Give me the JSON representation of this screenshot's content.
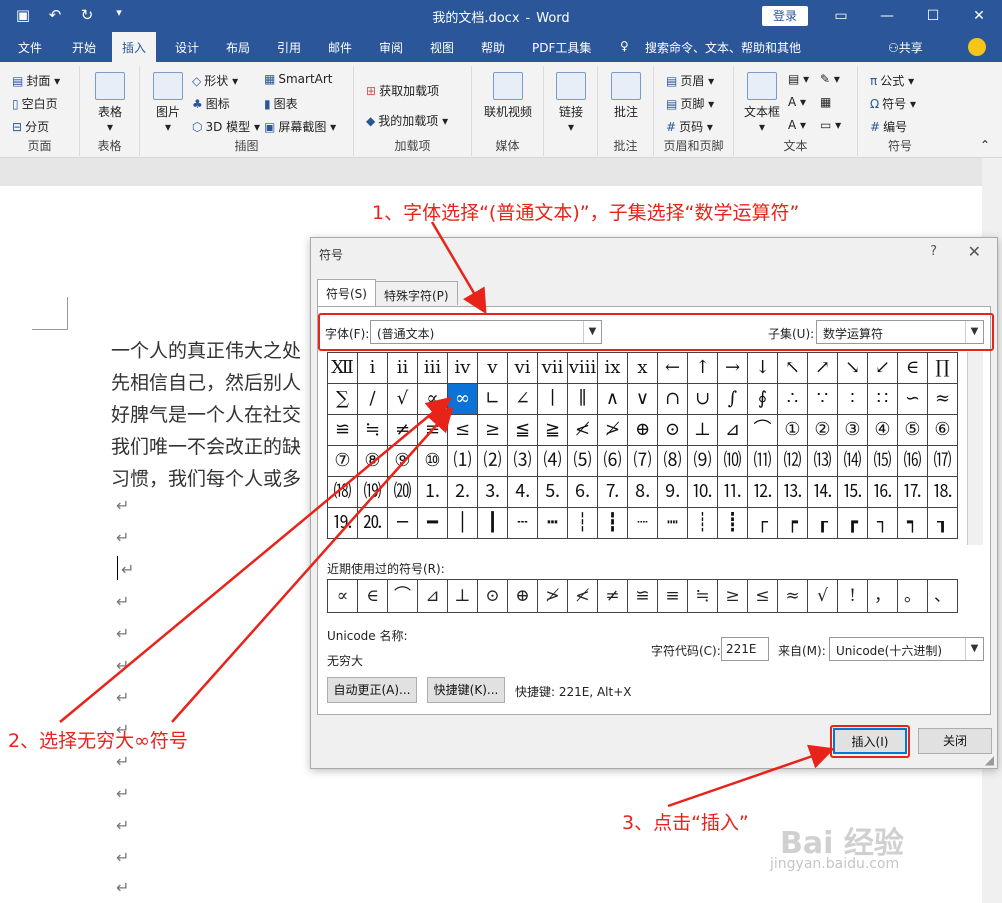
{
  "window": {
    "filename": "我的文档.docx",
    "separator": "-",
    "app": "Word",
    "login": "登录"
  },
  "tabs": [
    "文件",
    "开始",
    "插入",
    "设计",
    "布局",
    "引用",
    "邮件",
    "审阅",
    "视图",
    "帮助",
    "PDF工具集"
  ],
  "tell_me": "搜索命令、文本、帮助和其他",
  "share": "共享",
  "ribbon": {
    "pages": {
      "label": "页面",
      "items": [
        "封面",
        "空白页",
        "分页"
      ]
    },
    "tables": {
      "label": "表格",
      "items": [
        "表格"
      ]
    },
    "illustrations": {
      "label": "插图",
      "items": [
        "图片",
        "形状",
        "图标",
        "3D 模型",
        "SmartArt",
        "图表",
        "屏幕截图"
      ]
    },
    "addins": {
      "label": "加载项",
      "items": [
        "获取加载项",
        "我的加载项"
      ]
    },
    "media": {
      "label": "媒体",
      "items": [
        "联机视频"
      ]
    },
    "links": {
      "items": [
        "链接"
      ]
    },
    "comments": {
      "label": "批注",
      "items": [
        "批注"
      ]
    },
    "header_footer": {
      "label": "页眉和页脚",
      "items": [
        "页眉",
        "页脚",
        "页码"
      ]
    },
    "text": {
      "label": "文本",
      "items": [
        "文本框"
      ]
    },
    "symbols": {
      "label": "符号",
      "items": [
        "公式",
        "符号",
        "编号"
      ]
    }
  },
  "document": {
    "lines": [
      "一个人的真正伟大之处",
      "先相信自己，然后别人",
      "好脾气是一个人在社交",
      "我们唯一不会改正的缺",
      "习惯，我们每个人或多"
    ],
    "para_mark": "↵"
  },
  "annotations": {
    "step1": "1、字体选择“(普通文本)”，子集选择“数学运算符”",
    "step2": "2、选择无穷大∞符号",
    "step3": "3、点击“插入”"
  },
  "dialog": {
    "title": "符号",
    "help": "?",
    "close": "✕",
    "tab_symbols": "符号(S)",
    "tab_special": "特殊字符(P)",
    "font_label": "字体(F):",
    "font_value": "(普通文本)",
    "subset_label": "子集(U):",
    "subset_value": "数学运算符",
    "symbols": [
      "Ⅻ",
      "ⅰ",
      "ⅱ",
      "ⅲ",
      "ⅳ",
      "ⅴ",
      "ⅵ",
      "ⅶ",
      "ⅷ",
      "ⅸ",
      "ⅹ",
      "←",
      "↑",
      "→",
      "↓",
      "↖",
      "↗",
      "↘",
      "↙",
      "∈",
      "∏",
      "∑",
      "∕",
      "√",
      "∝",
      "∞",
      "∟",
      "∠",
      "∣",
      "∥",
      "∧",
      "∨",
      "∩",
      "∪",
      "∫",
      "∮",
      "∴",
      "∵",
      "∶",
      "∷",
      "∽",
      "≈",
      "≌",
      "≒",
      "≠",
      "≡",
      "≤",
      "≥",
      "≦",
      "≧",
      "≮",
      "≯",
      "⊕",
      "⊙",
      "⊥",
      "⊿",
      "⌒",
      "①",
      "②",
      "③",
      "④",
      "⑤",
      "⑥",
      "⑦",
      "⑧",
      "⑨",
      "⑩",
      "⑴",
      "⑵",
      "⑶",
      "⑷",
      "⑸",
      "⑹",
      "⑺",
      "⑻",
      "⑼",
      "⑽",
      "⑾",
      "⑿",
      "⒀",
      "⒁",
      "⒂",
      "⒃",
      "⒄",
      "⒅",
      "⒆",
      "⒇",
      "⒈",
      "⒉",
      "⒊",
      "⒋",
      "⒌",
      "⒍",
      "⒎",
      "⒏",
      "⒐",
      "⒑",
      "⒒",
      "⒓",
      "⒔",
      "⒕",
      "⒖",
      "⒗",
      "⒘",
      "⒙",
      "⒚",
      "⒛",
      "─",
      "━",
      "│",
      "┃",
      "┄",
      "┅",
      "┆",
      "┇",
      "┈",
      "┉",
      "┊",
      "┋",
      "┌",
      "┍",
      "┎",
      "┏",
      "┐",
      "┑",
      "┒"
    ],
    "selected_symbol": "∞",
    "recent_label": "近期使用过的符号(R):",
    "recent": [
      "∝",
      "∈",
      "⌒",
      "⊿",
      "⊥",
      "⊙",
      "⊕",
      "≯",
      "≮",
      "≠",
      "≌",
      "≡",
      "≒",
      "≥",
      "≤",
      "≈",
      "√",
      "!",
      "，",
      "。",
      "、"
    ],
    "unicode_name_label": "Unicode 名称:",
    "unicode_name": "无穷大",
    "char_code_label": "字符代码(C):",
    "char_code": "221E",
    "from_label": "来自(M):",
    "from_value": "Unicode(十六进制)",
    "autocorrect_btn": "自动更正(A)...",
    "shortcut_btn": "快捷键(K)...",
    "shortcut_text": "快捷键: 221E, Alt+X",
    "insert_btn": "插入(I)",
    "close_btn": "关闭"
  },
  "watermark": {
    "brand": "Bai 经验",
    "url": "jingyan.baidu.com"
  },
  "colors": {
    "word_blue": "#2b579a",
    "annotation_red": "#e8231a",
    "selection_blue": "#0b73d8"
  }
}
